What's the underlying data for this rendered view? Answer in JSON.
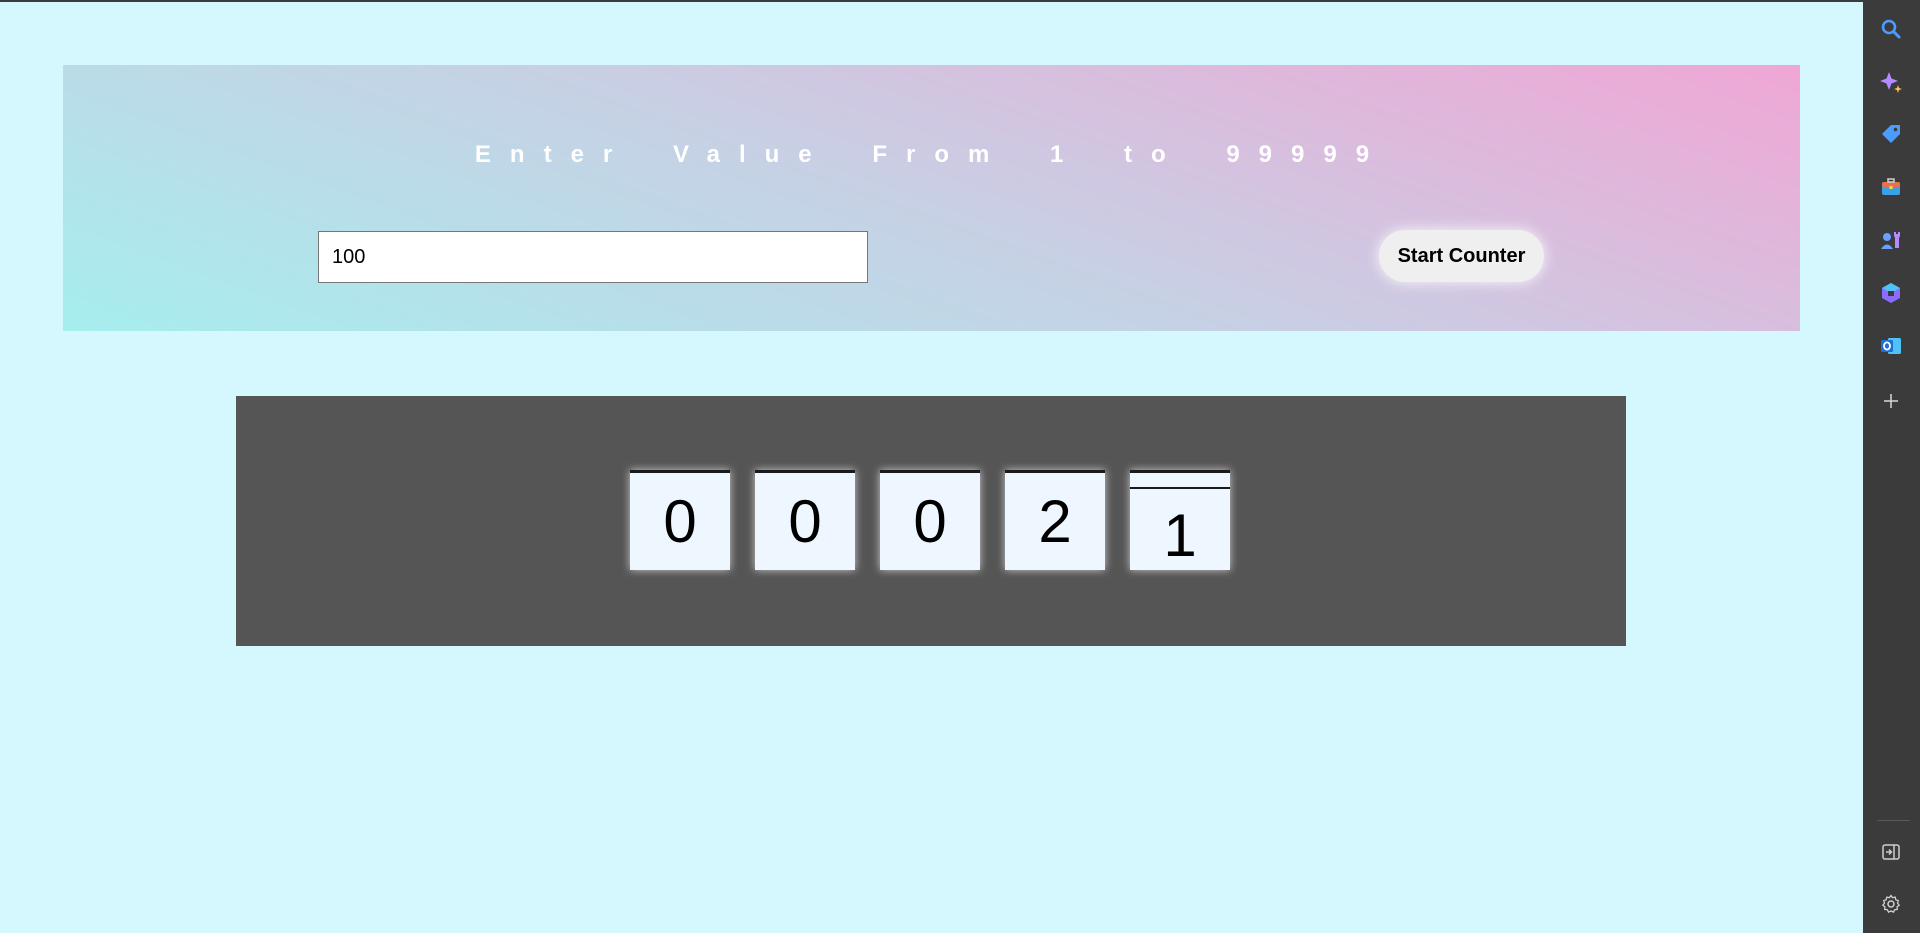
{
  "header": {
    "title": "Enter Value From 1 to 99999"
  },
  "form": {
    "input_value": "100",
    "button_label": "Start Counter"
  },
  "counter": {
    "digits": [
      "0",
      "0",
      "0",
      "2",
      "1"
    ]
  },
  "sidebar": {
    "icons": [
      {
        "name": "search-icon",
        "color": "#4c9bff"
      },
      {
        "name": "copilot-sparkle-icon",
        "color": "#b48cff"
      },
      {
        "name": "shopping-tag-icon",
        "color": "#4c9bff"
      },
      {
        "name": "tools-briefcase-icon",
        "color": "#e8704a"
      },
      {
        "name": "games-icon",
        "color": "#6aa0ff"
      },
      {
        "name": "microsoft-365-icon",
        "color": "#8a6cff"
      },
      {
        "name": "outlook-icon",
        "color": "#1e88e5"
      },
      {
        "name": "add-icon",
        "color": "#cfcfcf"
      },
      {
        "name": "sidebar-exit-icon",
        "color": "#cfcfcf"
      },
      {
        "name": "settings-gear-icon",
        "color": "#cfcfcf"
      }
    ]
  },
  "colors": {
    "page_background": "#d5f7fe",
    "counter_background": "#555555",
    "card_background": "#eef7ff",
    "sidebar_background": "#3b3b3b"
  }
}
